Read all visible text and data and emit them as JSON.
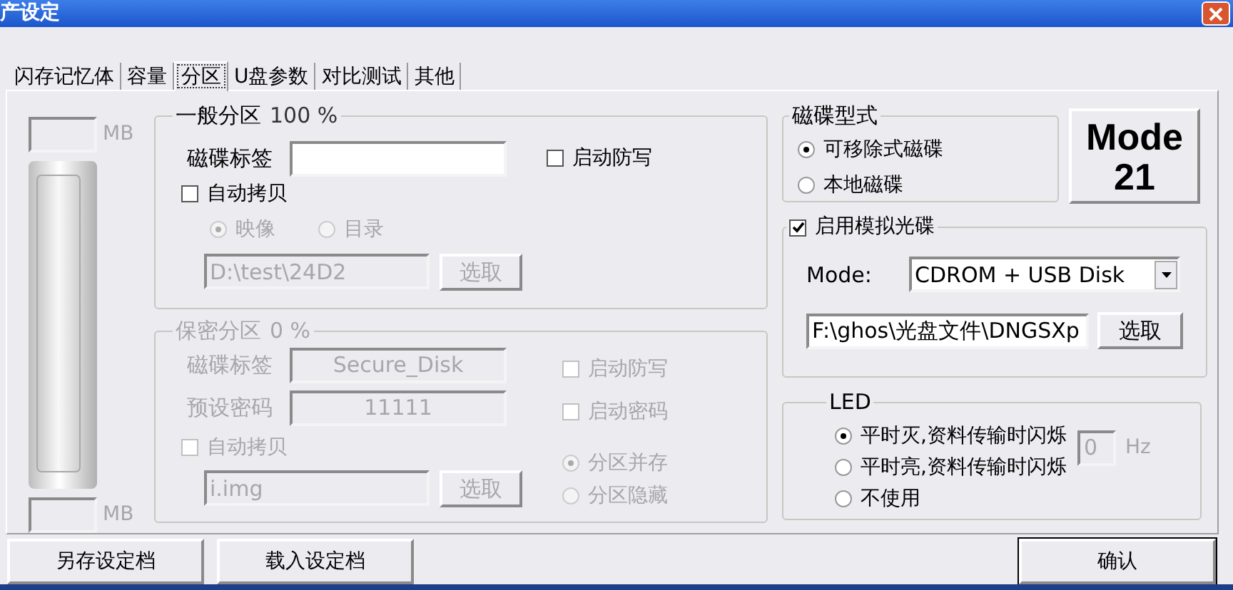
{
  "window": {
    "title": "产设定"
  },
  "tabs": [
    {
      "label": "闪存记忆体",
      "selected": false
    },
    {
      "label": "容量",
      "selected": false
    },
    {
      "label": "分区",
      "selected": true
    },
    {
      "label": "U盘参数",
      "selected": false
    },
    {
      "label": "对比测试",
      "selected": false
    },
    {
      "label": "其他",
      "selected": false
    }
  ],
  "capacity": {
    "top_unit": "MB",
    "bottom_unit": "MB"
  },
  "general_partition": {
    "legend": "一般分区",
    "percent": "100 %",
    "label_caption": "磁碟标签",
    "write_protect": {
      "label": "启动防写",
      "checked": false
    },
    "auto_copy": {
      "label": "自动拷贝",
      "checked": false
    },
    "copy_disabled": true,
    "copy_source": [
      {
        "label": "映像",
        "selected": true
      },
      {
        "label": "目录",
        "selected": false
      }
    ],
    "path": "D:\\test\\24D2",
    "browse": "选取"
  },
  "secure_partition": {
    "legend": "保密分区",
    "percent": "0 %",
    "disabled": true,
    "fields": [
      {
        "caption": "磁碟标签",
        "value": "Secure_Disk"
      },
      {
        "caption": "预设密码",
        "value": "11111"
      }
    ],
    "options": [
      {
        "label": "启动防写",
        "checked": false
      },
      {
        "label": "启动密码",
        "checked": false
      }
    ],
    "auto_copy": {
      "label": "自动拷贝",
      "checked": false
    },
    "path": "i.img",
    "browse": "选取",
    "modes": [
      {
        "label": "分区并存",
        "selected": true
      },
      {
        "label": "分区隐藏",
        "selected": false
      }
    ]
  },
  "disk_type": {
    "legend": "磁碟型式",
    "options": [
      {
        "label": "可移除式磁碟",
        "selected": true
      },
      {
        "label": "本地磁碟",
        "selected": false
      }
    ]
  },
  "mode_badge": {
    "title": "Mode",
    "number": "21"
  },
  "virtual_cd": {
    "label": "启用模拟光碟",
    "checked": true,
    "mode_label": "Mode:",
    "mode_value": "CDROM + USB Disk",
    "path": "F:\\ghos\\光盘文件\\DNGSXp",
    "browse": "选取"
  },
  "led": {
    "legend": "LED",
    "options": [
      {
        "label": "平时灭,资料传输时闪烁",
        "selected": true
      },
      {
        "label": "平时亮,资料传输时闪烁",
        "selected": false
      },
      {
        "label": "不使用",
        "selected": false
      }
    ],
    "frequency": "0",
    "unit": "Hz",
    "frequency_disabled": true
  },
  "footer_buttons": [
    {
      "label": "另存设定档",
      "default": false
    },
    {
      "label": "载入设定档",
      "default": false
    },
    {
      "label": "确认",
      "default": true
    }
  ]
}
